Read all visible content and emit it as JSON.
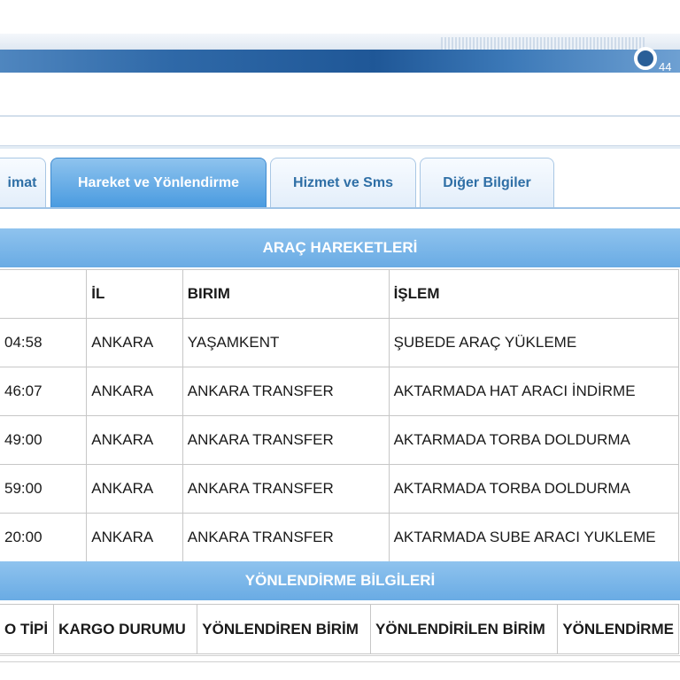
{
  "header": {
    "phone_text": "44"
  },
  "tabs": [
    {
      "label": "imat",
      "active": false
    },
    {
      "label": "Hareket ve Yönlendirme",
      "active": true
    },
    {
      "label": "Hizmet ve Sms",
      "active": false
    },
    {
      "label": "Diğer Bilgiler",
      "active": false
    }
  ],
  "movements": {
    "title": "ARAÇ HAREKETLERİ",
    "columns": [
      "",
      "İL",
      "BIRIM",
      "İŞLEM"
    ],
    "rows": [
      [
        "04:58",
        "ANKARA",
        "YAŞAMKENT",
        "ŞUBEDE ARAÇ YÜKLEME"
      ],
      [
        "46:07",
        "ANKARA",
        "ANKARA TRANSFER",
        "AKTARMADA HAT ARACI İNDİRME"
      ],
      [
        "49:00",
        "ANKARA",
        "ANKARA TRANSFER",
        "AKTARMADA TORBA DOLDURMA"
      ],
      [
        "59:00",
        "ANKARA",
        "ANKARA TRANSFER",
        "AKTARMADA TORBA DOLDURMA"
      ],
      [
        "20:00",
        "ANKARA",
        "ANKARA TRANSFER",
        "AKTARMADA SUBE ARACI YUKLEME"
      ]
    ]
  },
  "routing": {
    "title": "YÖNLENDİRME BİLGİLERİ",
    "columns": [
      "O TİPİ",
      "KARGO DURUMU",
      "YÖNLENDİREN BİRİM",
      "YÖNLENDİRİLEN BİRİM",
      "YÖNLENDİRME"
    ]
  },
  "colors": {
    "accent": "#4a9be0",
    "section_header": "#7bb6e9",
    "tab_text": "#2f6fa6"
  }
}
